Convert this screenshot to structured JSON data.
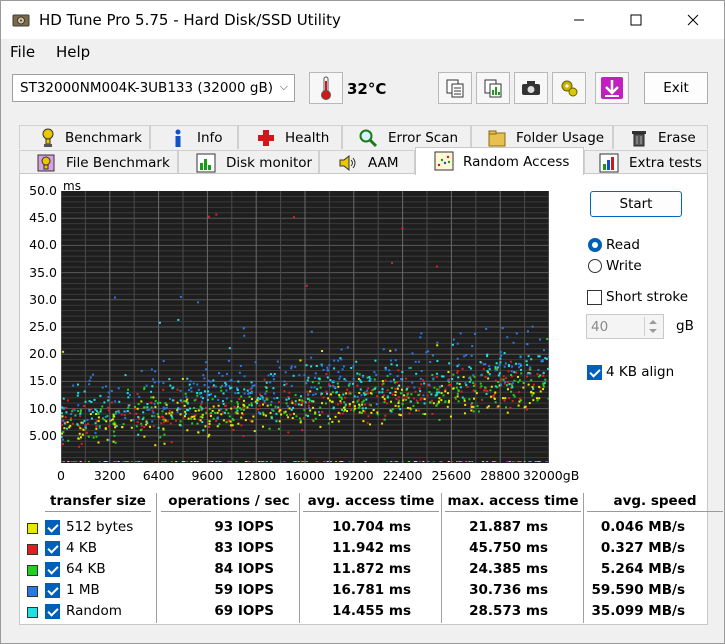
{
  "window": {
    "title": "HD Tune Pro 5.75 - Hard Disk/SSD Utility",
    "controls": [
      "minimize",
      "maximize",
      "close"
    ]
  },
  "menu": {
    "file": "File",
    "help": "Help"
  },
  "toolbar": {
    "drive": "ST32000NM004K-3UB133 (32000 gB)",
    "temperature": "32°C",
    "exit_label": "Exit"
  },
  "tabs_row1": [
    {
      "label": "Benchmark",
      "icon": "benchmark-icon"
    },
    {
      "label": "Info",
      "icon": "info-icon"
    },
    {
      "label": "Health",
      "icon": "health-icon"
    },
    {
      "label": "Error Scan",
      "icon": "error-scan-icon"
    },
    {
      "label": "Folder Usage",
      "icon": "folder-icon"
    },
    {
      "label": "Erase",
      "icon": "erase-icon"
    }
  ],
  "tabs_row2": [
    {
      "label": "File Benchmark",
      "icon": "file-benchmark-icon"
    },
    {
      "label": "Disk monitor",
      "icon": "disk-monitor-icon"
    },
    {
      "label": "AAM",
      "icon": "speaker-icon"
    },
    {
      "label": "Random Access",
      "icon": "random-access-icon",
      "active": true
    },
    {
      "label": "Extra tests",
      "icon": "extra-tests-icon"
    }
  ],
  "controls": {
    "start_label": "Start",
    "read_label": "Read",
    "write_label": "Write",
    "mode": "Read",
    "short_stroke_label": "Short stroke",
    "short_stroke_checked": false,
    "short_stroke_value": "40",
    "short_stroke_unit": "gB",
    "align_label": "4 KB align",
    "align_checked": true
  },
  "chart_data": {
    "type": "scatter",
    "ylabel": "ms",
    "xunit": "gB",
    "ylim": [
      0,
      50
    ],
    "xlim": [
      0,
      32000
    ],
    "yticks": [
      "50.0",
      "45.0",
      "40.0",
      "35.0",
      "30.0",
      "25.0",
      "20.0",
      "15.0",
      "10.0",
      "5.00"
    ],
    "xticks": [
      "0",
      "3200",
      "6400",
      "9600",
      "12800",
      "16000",
      "19200",
      "22400",
      "25600",
      "28800",
      "32000gB"
    ],
    "grid": true,
    "background": "#1e1e1e",
    "series": [
      {
        "name": "512 bytes",
        "color": "#e8e800",
        "avg_ms": 10.704,
        "max_ms": 21.887
      },
      {
        "name": "4 KB",
        "color": "#e02020",
        "avg_ms": 11.942,
        "max_ms": 45.75
      },
      {
        "name": "64 KB",
        "color": "#20d020",
        "avg_ms": 11.872,
        "max_ms": 24.385
      },
      {
        "name": "1 MB",
        "color": "#2878e8",
        "avg_ms": 16.781,
        "max_ms": 30.736
      },
      {
        "name": "Random",
        "color": "#20e0e0",
        "avg_ms": 14.455,
        "max_ms": 28.573
      }
    ]
  },
  "results": {
    "headers": [
      "transfer size",
      "operations / sec",
      "avg. access time",
      "max. access time",
      "avg. speed"
    ],
    "rows": [
      {
        "size": "512 bytes",
        "color": "#e8e800",
        "ops": "93 IOPS",
        "avg": "10.704 ms",
        "max": "21.887 ms",
        "speed": "0.046 MB/s"
      },
      {
        "size": "4 KB",
        "color": "#e02020",
        "ops": "83 IOPS",
        "avg": "11.942 ms",
        "max": "45.750 ms",
        "speed": "0.327 MB/s"
      },
      {
        "size": "64 KB",
        "color": "#20d020",
        "ops": "84 IOPS",
        "avg": "11.872 ms",
        "max": "24.385 ms",
        "speed": "5.264 MB/s"
      },
      {
        "size": "1 MB",
        "color": "#2878e8",
        "ops": "59 IOPS",
        "avg": "16.781 ms",
        "max": "30.736 ms",
        "speed": "59.590 MB/s"
      },
      {
        "size": "Random",
        "color": "#20e0e0",
        "ops": "69 IOPS",
        "avg": "14.455 ms",
        "max": "28.573 ms",
        "speed": "35.099 MB/s"
      }
    ]
  }
}
